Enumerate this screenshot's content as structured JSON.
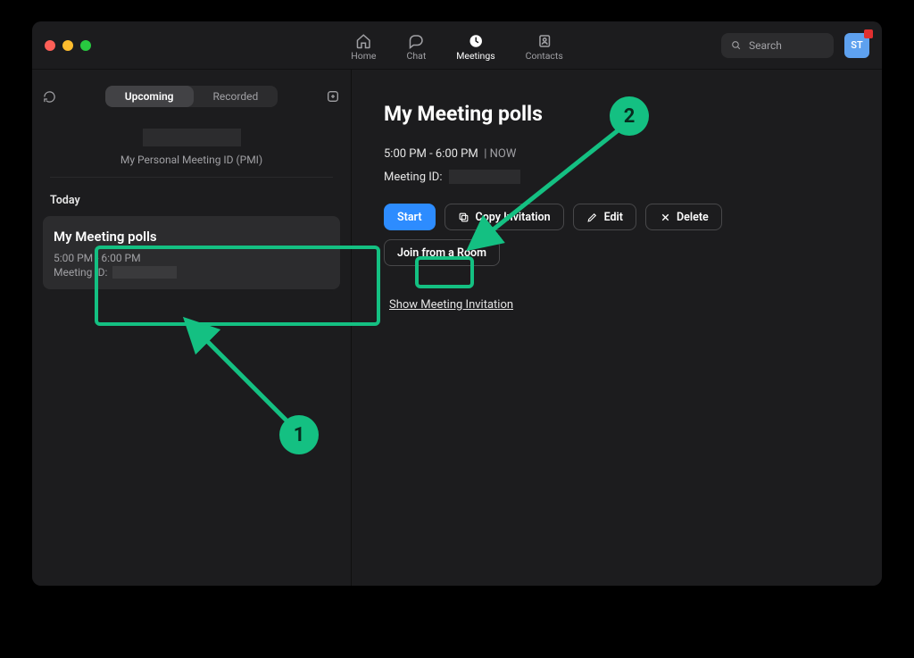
{
  "nav": {
    "home": "Home",
    "chat": "Chat",
    "meetings": "Meetings",
    "contacts": "Contacts",
    "active": "meetings"
  },
  "search": {
    "placeholder": "Search"
  },
  "avatar": {
    "initials": "ST"
  },
  "sidebar": {
    "tabs": {
      "upcoming": "Upcoming",
      "recorded": "Recorded",
      "active": "upcoming"
    },
    "pmi_label": "My Personal Meeting ID (PMI)",
    "today_label": "Today",
    "card": {
      "title": "My Meeting polls",
      "time": "5:00 PM - 6:00 PM",
      "meeting_id_label": "Meeting ID:"
    }
  },
  "main": {
    "title": "My Meeting polls",
    "time": "5:00 PM - 6:00 PM",
    "now_sep": "|",
    "now_label": "NOW",
    "meeting_id_label": "Meeting ID:",
    "buttons": {
      "start": "Start",
      "copy": "Copy Invitation",
      "edit": "Edit",
      "delete": "Delete",
      "join_room": "Join from a Room"
    },
    "show_invitation": "Show Meeting Invitation"
  },
  "annotations": {
    "one": "1",
    "two": "2"
  },
  "colors": {
    "accent": "#2d8cff",
    "green": "#14c082"
  }
}
